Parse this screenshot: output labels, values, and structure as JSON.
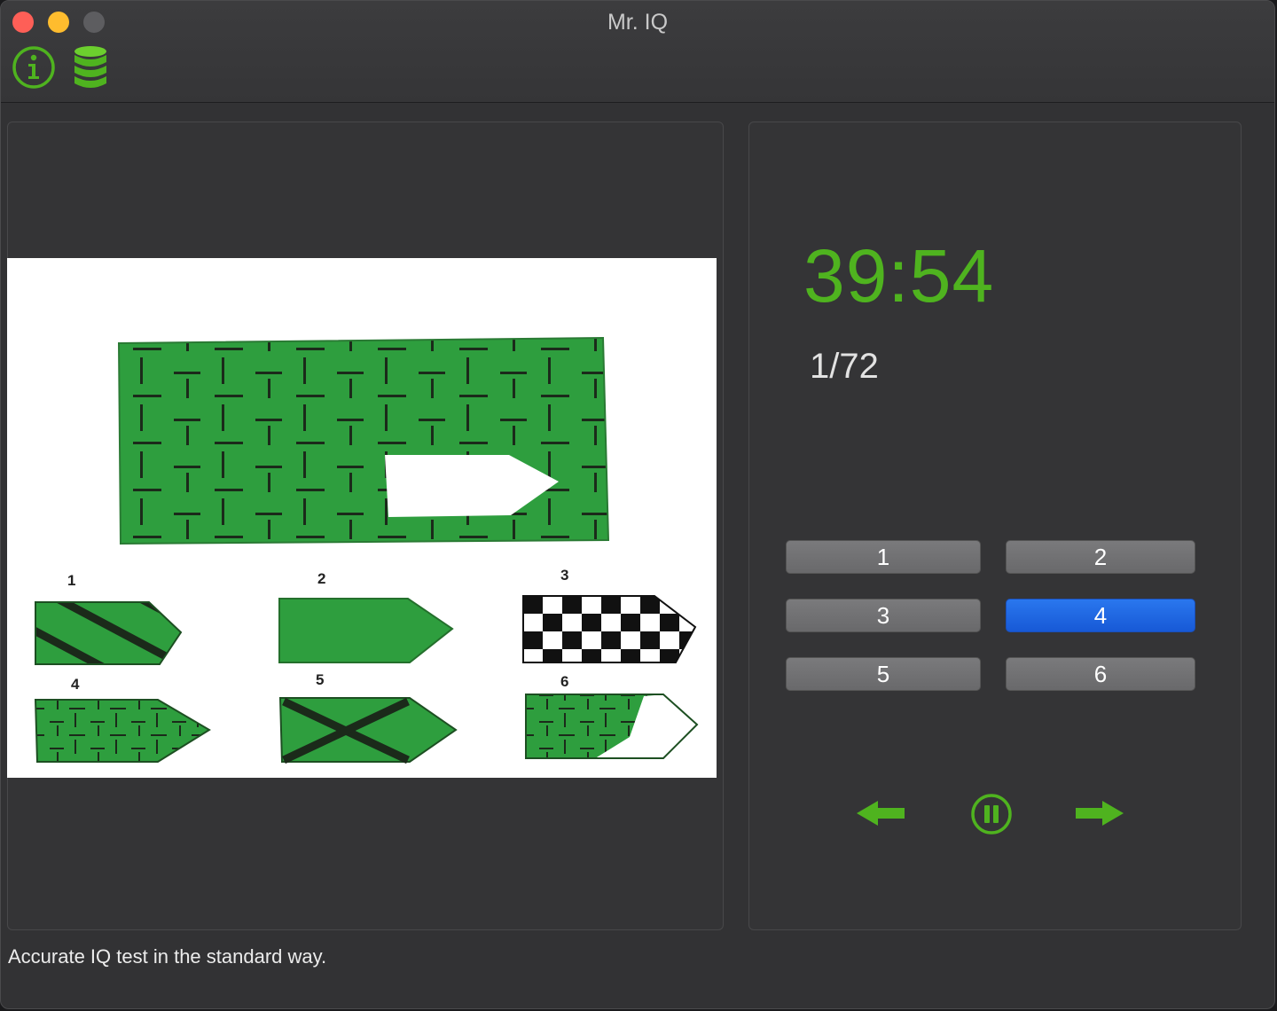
{
  "window": {
    "title": "Mr. IQ"
  },
  "toolbar": {
    "info_icon": "info-icon",
    "database_icon": "database-icon"
  },
  "question": {
    "option_labels": [
      "1",
      "2",
      "3",
      "4",
      "5",
      "6"
    ]
  },
  "status": {
    "timer": "39:54",
    "progress": "1/72"
  },
  "answers": [
    {
      "label": "1",
      "selected": false
    },
    {
      "label": "2",
      "selected": false
    },
    {
      "label": "3",
      "selected": false
    },
    {
      "label": "4",
      "selected": true
    },
    {
      "label": "5",
      "selected": false
    },
    {
      "label": "6",
      "selected": false
    }
  ],
  "navigation": {
    "previous_icon": "arrow-left-icon",
    "pause_icon": "pause-icon",
    "next_icon": "arrow-right-icon"
  },
  "footer": {
    "text": "Accurate IQ test in the standard way."
  },
  "colors": {
    "accent_green": "#4fb31f",
    "pattern_green": "#2e9e3e",
    "selected_blue": "#1f66e5",
    "window_bg": "#323234"
  }
}
